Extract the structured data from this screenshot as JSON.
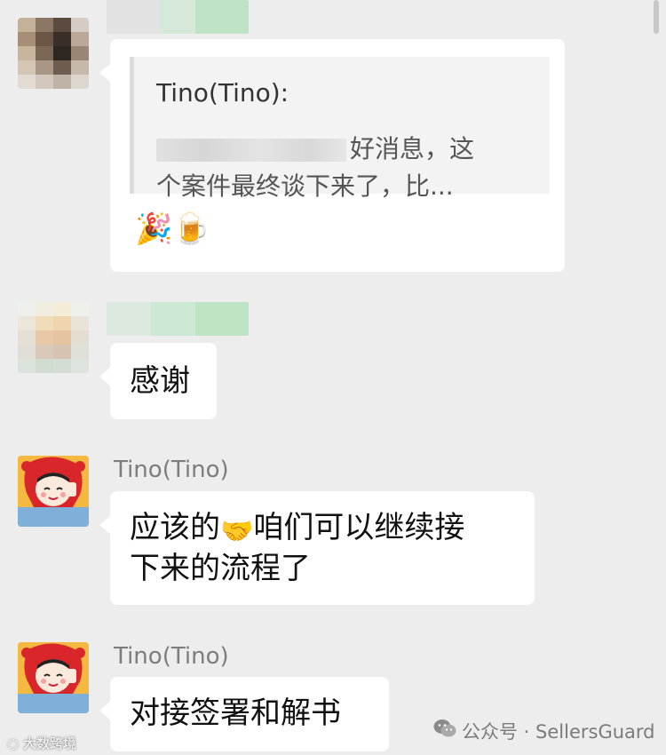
{
  "messages": {
    "quoted_reply": {
      "quote_author": "Tino(Tino):",
      "quote_line1": "好消息，这",
      "quote_line2": "个案件最终谈下来了，比...",
      "emojis": "🎉🍺"
    },
    "thanks": {
      "text": "感谢"
    },
    "tino_reply1": {
      "sender": "Tino(Tino)",
      "text_part1": "应该的",
      "handshake_emoji": "🤝",
      "text_part2": "咱们可以继续接",
      "text_line2": "下来的流程了"
    },
    "tino_reply2": {
      "sender": "Tino(Tino)",
      "text": "对接签署和解书"
    }
  },
  "watermarks": {
    "right": "公众号 · SellersGuard",
    "left": "大数跨境"
  },
  "icons": {
    "wechat": "wechat-icon"
  }
}
